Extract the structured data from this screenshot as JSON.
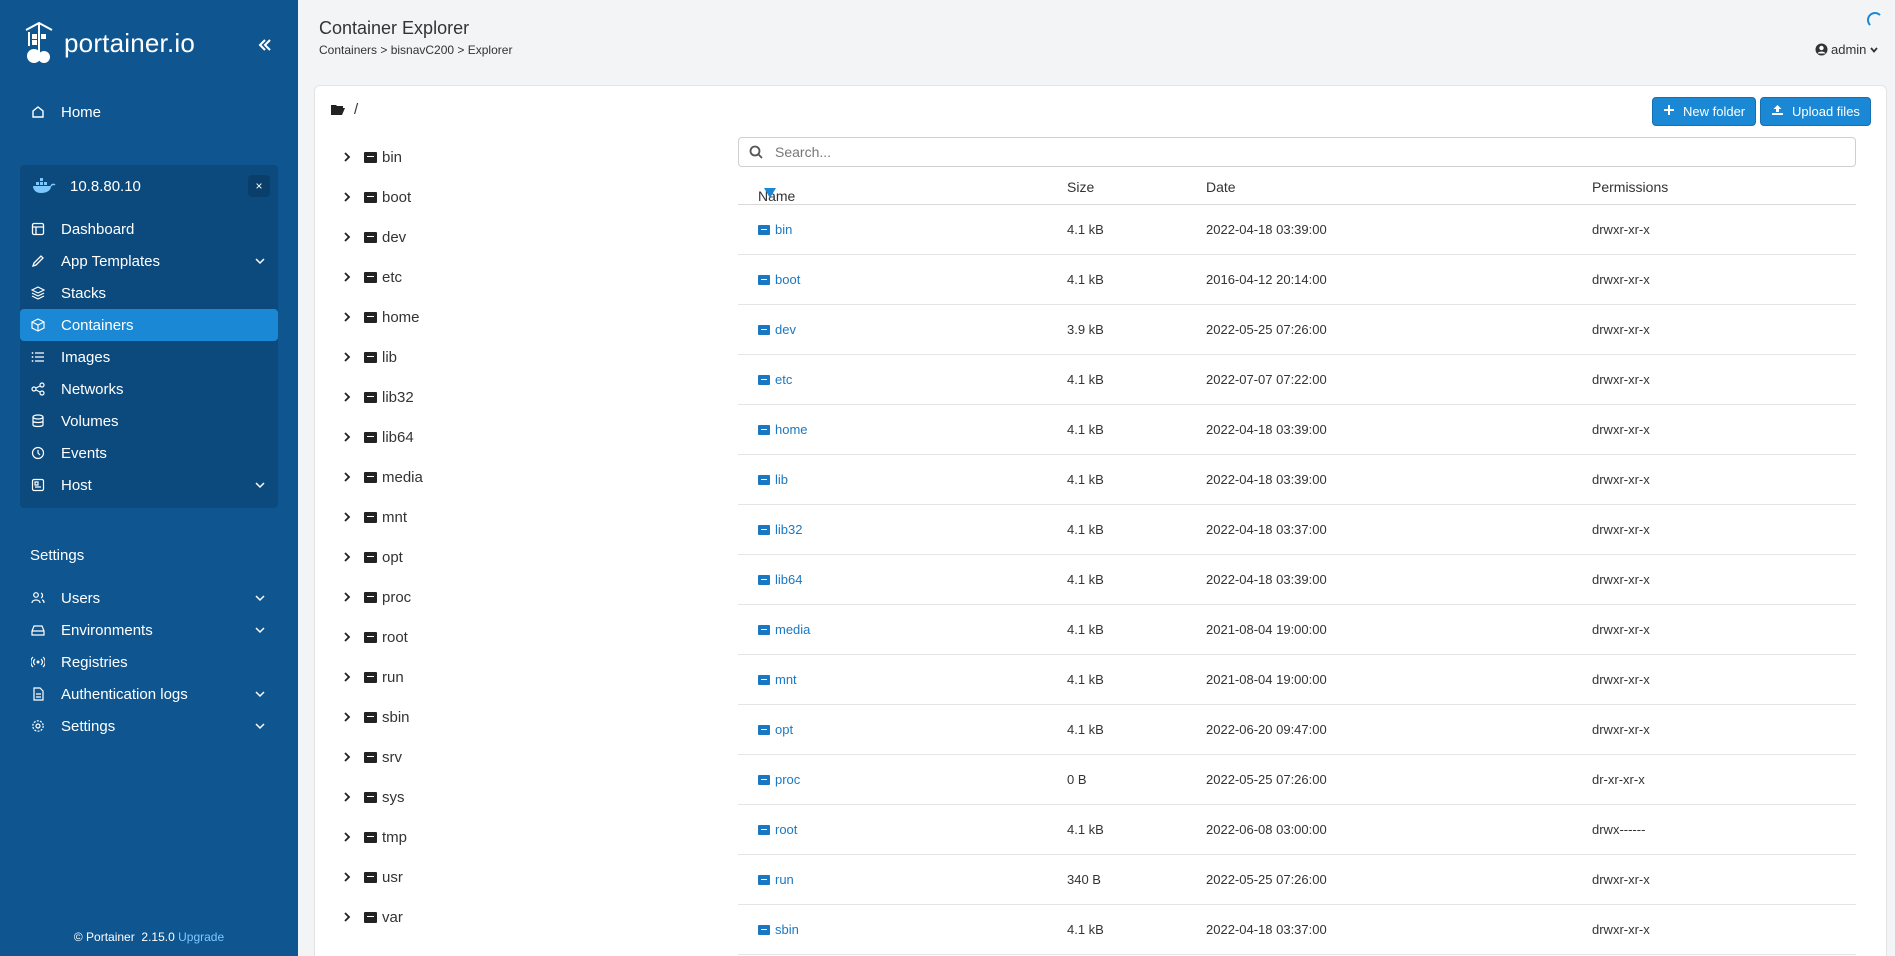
{
  "app": {
    "logo_text": "portainer.io",
    "footer_product": "© Portainer",
    "footer_version": "2.15.0",
    "footer_upgrade": "Upgrade"
  },
  "sidebar": {
    "home": "Home",
    "environment": {
      "name": "10.8.80.10",
      "close": "×"
    },
    "env_items": [
      {
        "label": "Dashboard",
        "icon": "dashboard-icon"
      },
      {
        "label": "App Templates",
        "icon": "edit-icon",
        "expandable": true
      },
      {
        "label": "Stacks",
        "icon": "layers-icon"
      },
      {
        "label": "Containers",
        "icon": "box-icon",
        "active": true
      },
      {
        "label": "Images",
        "icon": "list-icon"
      },
      {
        "label": "Networks",
        "icon": "share-icon"
      },
      {
        "label": "Volumes",
        "icon": "database-icon"
      },
      {
        "label": "Events",
        "icon": "clock-icon"
      },
      {
        "label": "Host",
        "icon": "server-icon",
        "expandable": true
      }
    ],
    "settings_heading": "Settings",
    "settings_items": [
      {
        "label": "Users",
        "icon": "users-icon",
        "expandable": true
      },
      {
        "label": "Environments",
        "icon": "hdd-icon",
        "expandable": true
      },
      {
        "label": "Registries",
        "icon": "radio-icon"
      },
      {
        "label": "Authentication logs",
        "icon": "file-icon",
        "expandable": true
      },
      {
        "label": "Settings",
        "icon": "gear-icon",
        "expandable": true
      }
    ]
  },
  "header": {
    "title": "Container Explorer",
    "breadcrumb": "Containers > bisnavC200 > Explorer",
    "user": "admin"
  },
  "explorer": {
    "path": "/",
    "new_folder": "New folder",
    "upload_files": "Upload files",
    "search_placeholder": "Search...",
    "tree": [
      "bin",
      "boot",
      "dev",
      "etc",
      "home",
      "lib",
      "lib32",
      "lib64",
      "media",
      "mnt",
      "opt",
      "proc",
      "root",
      "run",
      "sbin",
      "srv",
      "sys",
      "tmp",
      "usr",
      "var"
    ],
    "columns": {
      "name": "Name",
      "size": "Size",
      "date": "Date",
      "permissions": "Permissions"
    },
    "rows": [
      {
        "name": "bin",
        "size": "4.1 kB",
        "date": "2022-04-18 03:39:00",
        "perm": "drwxr-xr-x"
      },
      {
        "name": "boot",
        "size": "4.1 kB",
        "date": "2016-04-12 20:14:00",
        "perm": "drwxr-xr-x"
      },
      {
        "name": "dev",
        "size": "3.9 kB",
        "date": "2022-05-25 07:26:00",
        "perm": "drwxr-xr-x"
      },
      {
        "name": "etc",
        "size": "4.1 kB",
        "date": "2022-07-07 07:22:00",
        "perm": "drwxr-xr-x"
      },
      {
        "name": "home",
        "size": "4.1 kB",
        "date": "2022-04-18 03:39:00",
        "perm": "drwxr-xr-x"
      },
      {
        "name": "lib",
        "size": "4.1 kB",
        "date": "2022-04-18 03:39:00",
        "perm": "drwxr-xr-x"
      },
      {
        "name": "lib32",
        "size": "4.1 kB",
        "date": "2022-04-18 03:37:00",
        "perm": "drwxr-xr-x"
      },
      {
        "name": "lib64",
        "size": "4.1 kB",
        "date": "2022-04-18 03:39:00",
        "perm": "drwxr-xr-x"
      },
      {
        "name": "media",
        "size": "4.1 kB",
        "date": "2021-08-04 19:00:00",
        "perm": "drwxr-xr-x"
      },
      {
        "name": "mnt",
        "size": "4.1 kB",
        "date": "2021-08-04 19:00:00",
        "perm": "drwxr-xr-x"
      },
      {
        "name": "opt",
        "size": "4.1 kB",
        "date": "2022-06-20 09:47:00",
        "perm": "drwxr-xr-x"
      },
      {
        "name": "proc",
        "size": "0 B",
        "date": "2022-05-25 07:26:00",
        "perm": "dr-xr-xr-x"
      },
      {
        "name": "root",
        "size": "4.1 kB",
        "date": "2022-06-08 03:00:00",
        "perm": "drwx------"
      },
      {
        "name": "run",
        "size": "340 B",
        "date": "2022-05-25 07:26:00",
        "perm": "drwxr-xr-x"
      },
      {
        "name": "sbin",
        "size": "4.1 kB",
        "date": "2022-04-18 03:37:00",
        "perm": "drwxr-xr-x"
      }
    ]
  }
}
